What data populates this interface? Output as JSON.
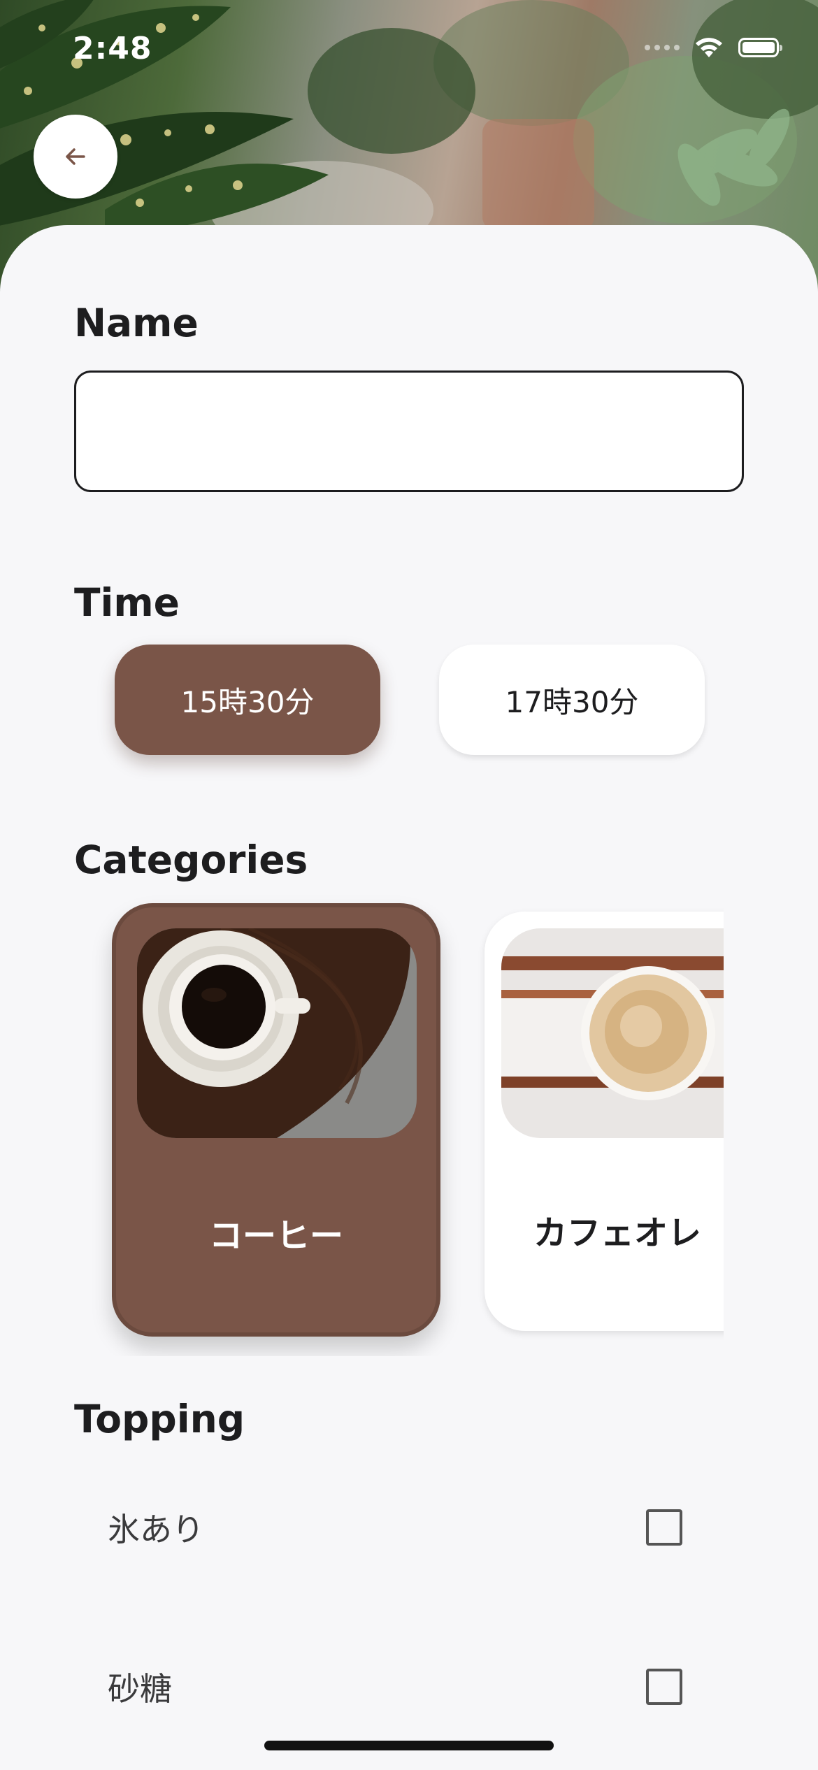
{
  "status_bar": {
    "time": "2:48"
  },
  "header": {
    "back_icon": "arrow-left-icon",
    "back_icon_color": "#7a5548"
  },
  "form": {
    "name": {
      "label": "Name",
      "value": "",
      "placeholder": ""
    },
    "time": {
      "label": "Time",
      "options": [
        {
          "label": "15時30分",
          "selected": true
        },
        {
          "label": "17時30分",
          "selected": false
        }
      ]
    },
    "categories": {
      "label": "Categories",
      "items": [
        {
          "label": "コーヒー",
          "selected": true
        },
        {
          "label": "カフェオレ",
          "selected": false
        }
      ]
    },
    "topping": {
      "label": "Topping",
      "items": [
        {
          "label": "氷あり",
          "checked": false
        },
        {
          "label": "砂糖",
          "checked": false
        }
      ]
    }
  },
  "colors": {
    "accent": "#7a5548",
    "background": "#f7f7f9",
    "card": "#ffffff",
    "text": "#1d1d1f"
  }
}
